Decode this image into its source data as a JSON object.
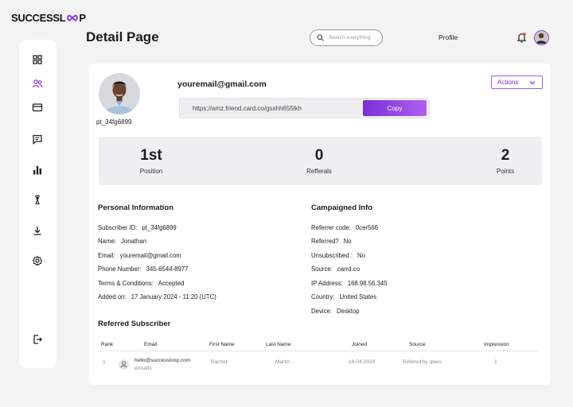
{
  "brand": {
    "name_part1": "SUCCESSL",
    "name_part2": "P",
    "accent": "#8a3ff0"
  },
  "sidebar": {
    "items": [
      {
        "name": "dashboard-icon"
      },
      {
        "name": "users-icon",
        "active": true
      },
      {
        "name": "card-icon"
      },
      {
        "name": "message-icon"
      },
      {
        "name": "bar-chart-icon"
      },
      {
        "name": "broadcast-icon"
      },
      {
        "name": "download-icon"
      },
      {
        "name": "settings-icon"
      },
      {
        "name": "logout-icon"
      }
    ]
  },
  "header": {
    "title": "Detail Page",
    "search_placeholder": "Search everything",
    "profile_label": "Profile"
  },
  "subscriber": {
    "id": "pt_34fg6899",
    "email": "youremail@gmail.com",
    "referral_url": "https://amz.friend.card.co/gsshh655lkh",
    "copy_label": "Copy",
    "actions_label": "Actions"
  },
  "stats": [
    {
      "value": "1st",
      "label": "Position"
    },
    {
      "value": "0",
      "label": "Refferals"
    },
    {
      "value": "2",
      "label": "Points"
    }
  ],
  "personal_info": {
    "title": "Personal Information",
    "rows": [
      {
        "label": "Subscriber ID:",
        "value": "pt_34fg6899"
      },
      {
        "label": "Name:",
        "value": "Jonathan"
      },
      {
        "label": "Email:",
        "value": "youremail@gmail.com"
      },
      {
        "label": "Phone Number:",
        "value": "345-6544-8977"
      },
      {
        "label": "Terms & Conditions:",
        "value": "Accepted"
      },
      {
        "label": "Added on:",
        "value": "17 January 2024 - 11:20 (UTC)"
      }
    ]
  },
  "campaign_info": {
    "title": "Campaigned Info",
    "rows": [
      {
        "label": "Referrer code:",
        "value": "0cer566"
      },
      {
        "label": "Referred?",
        "value": "No"
      },
      {
        "label": "Unsubscribed :",
        "value": "No"
      },
      {
        "label": "Source:",
        "value": "carrd.co"
      },
      {
        "label": "IP Address:",
        "value": "168.98.56.345"
      },
      {
        "label": "Country:",
        "value": "United States"
      },
      {
        "label": "Device:",
        "value": "Desktop"
      }
    ]
  },
  "referred": {
    "title": "Referred Subscriber",
    "columns": [
      "Rank",
      "Email",
      "First Name",
      "Last Name",
      "Joined",
      "Source",
      "Impression"
    ],
    "rows": [
      {
        "rank": "1",
        "email": "hello@successloop.com",
        "sub": "wcsattx",
        "first": "Rachel",
        "last": "Martin",
        "joined": "16-04-2024",
        "source": "Refered by qwes",
        "impression": "1"
      }
    ]
  }
}
